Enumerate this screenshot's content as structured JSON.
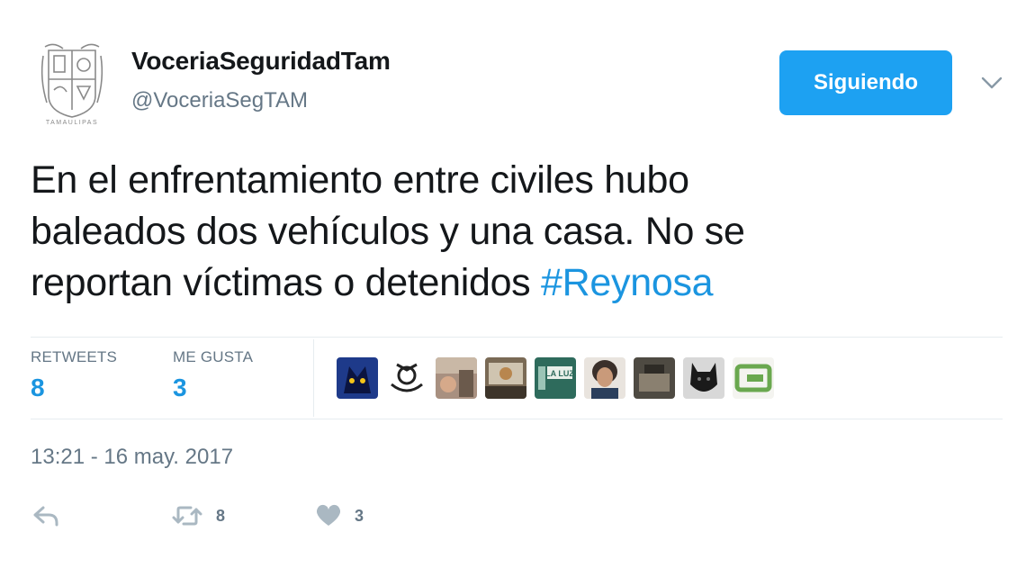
{
  "account": {
    "display_name": "VoceriaSeguridadTam",
    "handle": "@VoceriaSegTAM",
    "avatar_caption": "TAMAULIPAS",
    "avatar_icon": "tamaulipas-coat-of-arms"
  },
  "follow_button": {
    "label": "Siguiendo",
    "color": "#1da1f2"
  },
  "menu": {
    "icon": "chevron-down-icon"
  },
  "tweet": {
    "lines": [
      "En el enfrentamiento entre civiles hubo",
      "baleados dos vehículos y una casa. No se",
      "reportan víctimas o detenidos "
    ],
    "hashtag": "#Reynosa",
    "hashtag_color": "#1b95e0"
  },
  "stats": {
    "retweets_label": "RETWEETS",
    "retweets_count": "8",
    "likes_label": "ME GUSTA",
    "likes_count": "3"
  },
  "likers": [
    {
      "name": "liker-avatar-blue-mask",
      "color": "#1e3a8a"
    },
    {
      "name": "liker-avatar-emblem",
      "color": "#ffffff"
    },
    {
      "name": "liker-avatar-photo-1",
      "color": "#a89080"
    },
    {
      "name": "liker-avatar-photo-2",
      "color": "#7a6a55"
    },
    {
      "name": "liker-avatar-la-luz",
      "color": "#2e6b5c",
      "text": "LA LUZ"
    },
    {
      "name": "liker-avatar-woman",
      "color": "#3a2f2a"
    },
    {
      "name": "liker-avatar-photo-3",
      "color": "#4e4a42"
    },
    {
      "name": "liker-avatar-dog",
      "color": "#1a1a1a"
    },
    {
      "name": "liker-avatar-green-logo",
      "color": "#6aa84f"
    }
  ],
  "timestamp": "13:21 - 16 may. 2017",
  "actions": {
    "reply_icon": "reply-icon",
    "retweet_icon": "retweet-icon",
    "retweet_count": "8",
    "like_icon": "heart-icon",
    "like_count": "3",
    "icon_color": "#aab8c2"
  }
}
